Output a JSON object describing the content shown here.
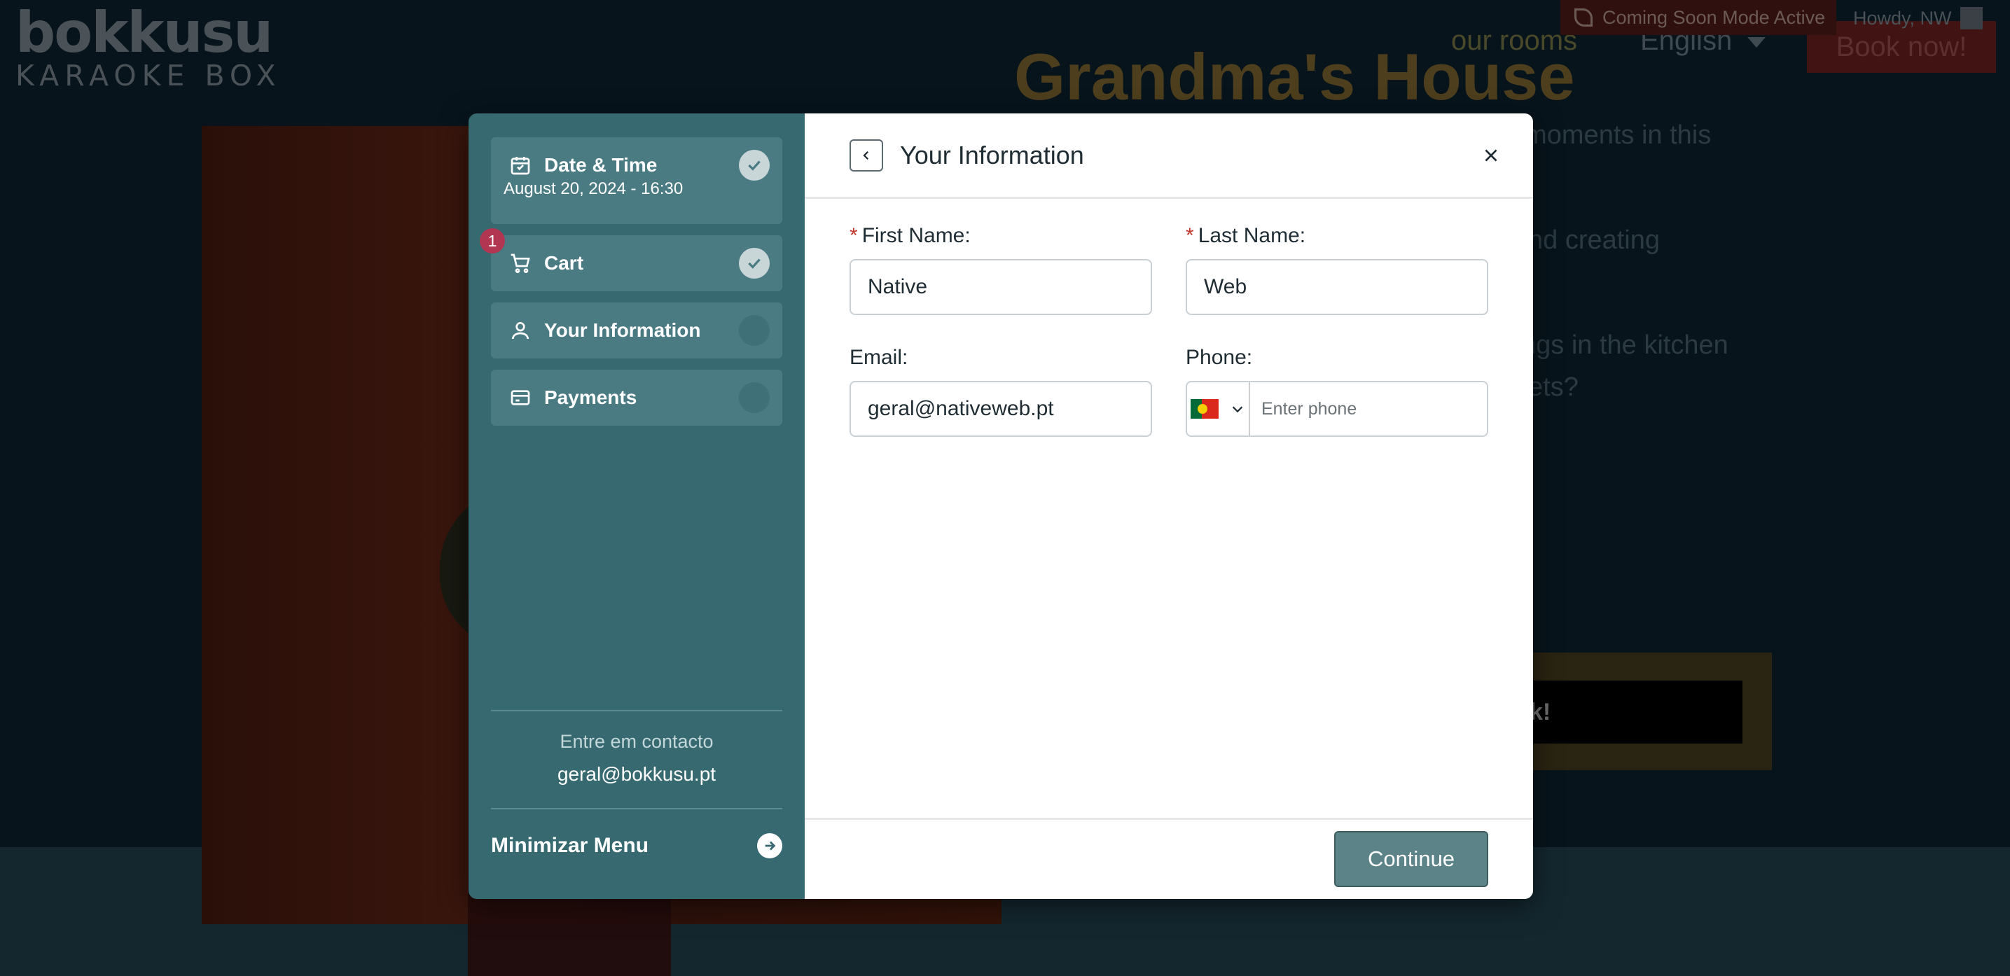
{
  "site": {
    "logo_top": "bokkusu",
    "logo_bottom": "KARAOKE BOX",
    "nav_rooms": "our rooms",
    "nav_language": "English",
    "book_now": "Book now!",
    "admin_notice": "Coming Soon Mode Active",
    "admin_user": "Howdy, NW",
    "hero_title": "Grandma's House",
    "hero_lines": [
      "t moments in this",
      "nd creating",
      "ngs in the kitchen",
      "ets?"
    ],
    "cta_fragment": "k!"
  },
  "modal": {
    "steps": [
      {
        "label": "Date & Time",
        "sub": "August 20, 2024 - 16:30",
        "icon": "calendar-icon",
        "status": "done"
      },
      {
        "label": "Cart",
        "icon": "cart-icon",
        "status": "done",
        "badge": "1"
      },
      {
        "label": "Your Information",
        "icon": "user-icon",
        "status": "pending"
      },
      {
        "label": "Payments",
        "icon": "card-icon",
        "status": "pending"
      }
    ],
    "contact_label": "Entre em contacto",
    "contact_email": "geral@bokkusu.pt",
    "minimize_label": "Minimizar Menu",
    "header_title": "Your Information",
    "form": {
      "first_name_label": "First Name:",
      "first_name_value": "Native",
      "last_name_label": "Last Name:",
      "last_name_value": "Web",
      "email_label": "Email:",
      "email_value": "geral@nativeweb.pt",
      "phone_label": "Phone:",
      "phone_placeholder": "Enter phone",
      "required_mark": "*"
    },
    "continue_label": "Continue",
    "colors": {
      "sidebar": "#376970",
      "step": "#4a7b82",
      "badge": "#b23552",
      "button": "#5c8388"
    }
  }
}
